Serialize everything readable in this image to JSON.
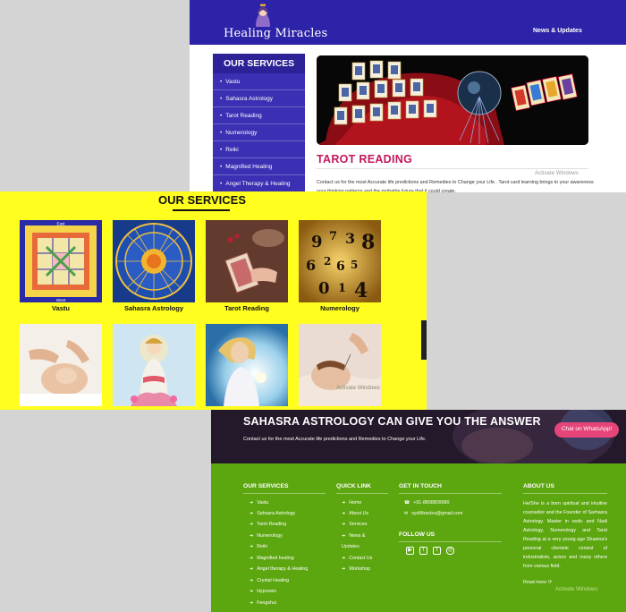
{
  "panel1": {
    "brand": "Healing Miracles",
    "nav_news": "News & Updates",
    "sidebar_title": "OUR SERVICES",
    "sidebar_items": [
      "Vastu",
      "Sahasra Astrology",
      "Tarot Reading",
      "Numerology",
      "Reiki",
      "Magnified Healing",
      "Angel Therapy & Healing"
    ],
    "heading": "TAROT READING",
    "description": "Contact us for the most Accurate life predictions and Remedies to Change your Life.. Tarot card learning brings to your awareness your thinking patterns and the probable future that it could create.",
    "watermark": "Activate Windows"
  },
  "panel2": {
    "title": "OUR SERVICES",
    "tiles": [
      {
        "label": "Vastu",
        "icon": "vastu-grid-image"
      },
      {
        "label": "Sahasra Astrology",
        "icon": "zodiac-wheel-image"
      },
      {
        "label": "Tarot Reading",
        "icon": "tarot-cards-image"
      },
      {
        "label": "Numerology",
        "icon": "numbers-image"
      },
      {
        "label": "",
        "icon": "reiki-image"
      },
      {
        "label": "",
        "icon": "deity-image"
      },
      {
        "label": "",
        "icon": "angel-image"
      },
      {
        "label": "",
        "icon": "healing-image"
      }
    ],
    "watermark": "Activate Windows"
  },
  "panel3": {
    "hero_title": "SAHASRA ASTROLOGY CAN GIVE YOU THE ANSWER",
    "hero_sub": "Contact us for the most Accurate life predictions and Remedies to Change your Life.",
    "chat_button": "Chat on WhatsApp!",
    "services_heading": "OUR SERVICES",
    "services": [
      "Vastu",
      "Sahasra Astrology",
      "Tarot Reading",
      "Numerology",
      "Reiki",
      "Magnified healing",
      "Angel therapy & Healing",
      "Crystal Healing",
      "Hypnosis",
      "Fengshui"
    ],
    "quick_heading": "QUICK LINK",
    "quick_links": [
      "Home",
      "About Us",
      "Services",
      "News &",
      "Updates",
      "Contact Us",
      "Workshop"
    ],
    "touch_heading": "GET IN TOUCH",
    "phone": "+91-8808809990",
    "email": "sysMiracles@gmail.com",
    "follow_heading": "FOLLOW US",
    "social_icons": [
      "youtube-icon",
      "facebook-icon",
      "twitter-icon",
      "instagram-icon"
    ],
    "about_heading": "ABOUT US",
    "about_text": "He/She is a born spiritual and intuitive counsellor and the Founder of Sarhasra Astrology. Master in vedic and Nadi Astrology, Numerology and Tarot Reading at a very young age Shaeina's personal clientele consist of industrialists, actors and many others from various field.",
    "read_more": "Read more",
    "watermark": "Activate Windows"
  },
  "colors": {
    "header_blue": "#2d23a8",
    "sidebar_purple": "#3b30b3",
    "heading_pink": "#c2185b",
    "services_yellow": "#fffe1f",
    "footer_green": "#5ca60f",
    "chat_pink": "#e6457a"
  }
}
